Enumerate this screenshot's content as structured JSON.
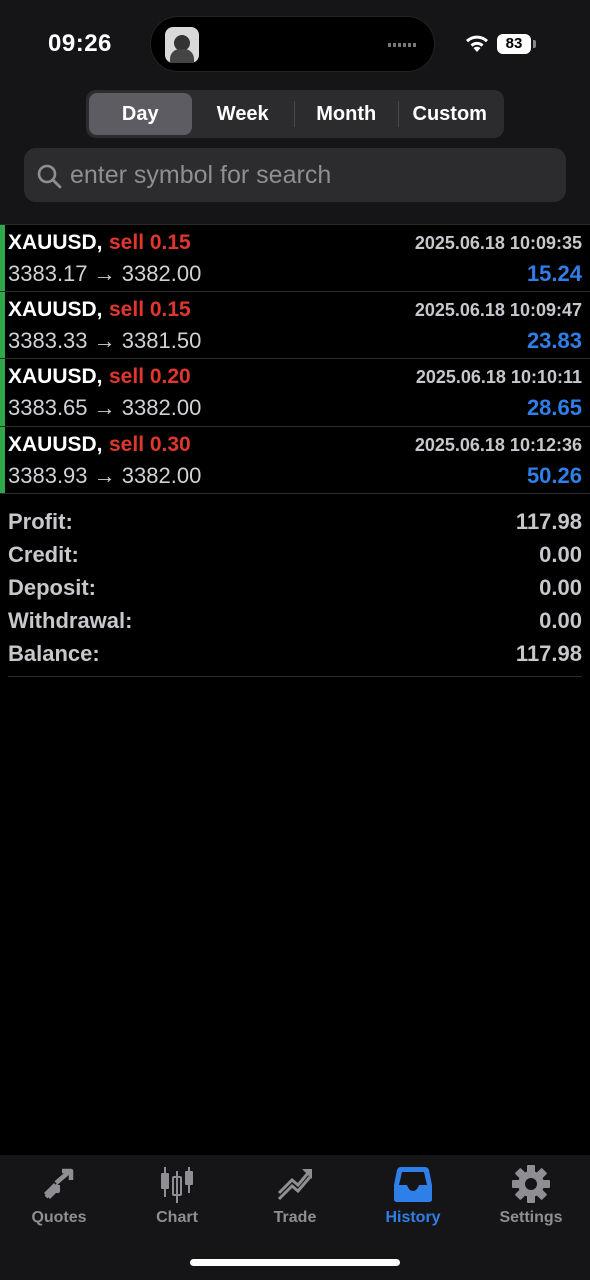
{
  "status": {
    "time": "09:26",
    "battery": "83",
    "icons": [
      "wifi-icon",
      "battery-icon"
    ]
  },
  "period_tabs": [
    {
      "label": "Day",
      "active": true
    },
    {
      "label": "Week",
      "active": false
    },
    {
      "label": "Month",
      "active": false
    },
    {
      "label": "Custom",
      "active": false
    }
  ],
  "search": {
    "placeholder": "enter symbol for search",
    "value": ""
  },
  "deals": [
    {
      "symbol": "XAUUSD,",
      "type": "sell 0.15",
      "time": "2025.06.18 10:09:35",
      "open": "3383.17",
      "close": "3382.00",
      "arrow": "→",
      "profit": "15.24"
    },
    {
      "symbol": "XAUUSD,",
      "type": "sell 0.15",
      "time": "2025.06.18 10:09:47",
      "open": "3383.33",
      "close": "3381.50",
      "arrow": "→",
      "profit": "23.83"
    },
    {
      "symbol": "XAUUSD,",
      "type": "sell 0.20",
      "time": "2025.06.18 10:10:11",
      "open": "3383.65",
      "close": "3382.00",
      "arrow": "→",
      "profit": "28.65"
    },
    {
      "symbol": "XAUUSD,",
      "type": "sell 0.30",
      "time": "2025.06.18 10:12:36",
      "open": "3383.93",
      "close": "3382.00",
      "arrow": "→",
      "profit": "50.26"
    }
  ],
  "summary": {
    "profit_label": "Profit:",
    "profit": "117.98",
    "credit_label": "Credit:",
    "credit": "0.00",
    "deposit_label": "Deposit:",
    "deposit": "0.00",
    "withdrawal_label": "Withdrawal:",
    "withdrawal": "0.00",
    "balance_label": "Balance:",
    "balance": "117.98"
  },
  "tabbar": [
    {
      "label": "Quotes",
      "icon": "quotes-icon",
      "active": false
    },
    {
      "label": "Chart",
      "icon": "chart-icon",
      "active": false
    },
    {
      "label": "Trade",
      "icon": "trade-icon",
      "active": false
    },
    {
      "label": "History",
      "icon": "history-icon",
      "active": true
    },
    {
      "label": "Settings",
      "icon": "settings-icon",
      "active": false
    }
  ],
  "colors": {
    "sell": "#e0362e",
    "profit": "#2f7fe8",
    "accent": "#2f7fe8",
    "deal_bar": "#2fa84a",
    "background": "#000000",
    "header_bg": "#151517"
  }
}
